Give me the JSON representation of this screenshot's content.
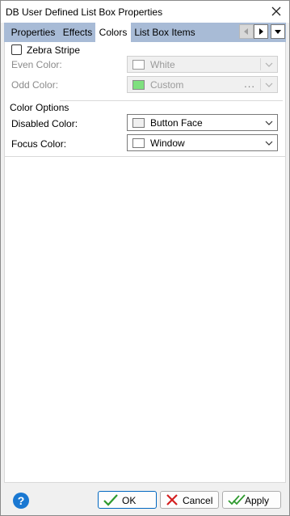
{
  "window": {
    "title": "DB User Defined List Box Properties"
  },
  "tabs": [
    {
      "label": "Properties"
    },
    {
      "label": "Effects"
    },
    {
      "label": "Colors"
    },
    {
      "label": "List Box Items"
    }
  ],
  "zebra": {
    "checkbox_label": "Zebra Stripe",
    "checked": false,
    "even_label": "Even Color:",
    "even_value": "White",
    "even_swatch": "#ffffff",
    "odd_label": "Odd Color:",
    "odd_value": "Custom",
    "odd_swatch": "#7ee07e",
    "odd_dots": "..."
  },
  "color_options": {
    "group_label": "Color Options",
    "disabled_label": "Disabled Color:",
    "disabled_value": "Button Face",
    "disabled_swatch": "#f0f0f0",
    "focus_label": "Focus Color:",
    "focus_value": "Window",
    "focus_swatch": "#ffffff"
  },
  "buttons": {
    "help": "?",
    "ok": "OK",
    "cancel": "Cancel",
    "apply": "Apply"
  },
  "colors": {
    "tab_strip": "#a8bbd6",
    "help_blue": "#1a78d2",
    "ok_green": "#2e9a2e",
    "cancel_red": "#d42020"
  }
}
